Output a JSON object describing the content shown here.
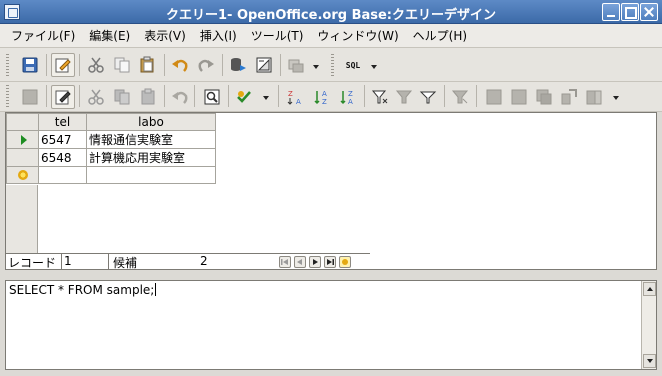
{
  "window": {
    "title": "クエリー1-  OpenOffice.org Base:クエリーデザイン"
  },
  "menu": {
    "items": [
      {
        "label": "ファイル(F)"
      },
      {
        "label": "編集(E)"
      },
      {
        "label": "表示(V)"
      },
      {
        "label": "挿入(I)"
      },
      {
        "label": "ツール(T)"
      },
      {
        "label": "ウィンドウ(W)"
      },
      {
        "label": "ヘルプ(H)"
      }
    ]
  },
  "toolbar1": {
    "sql_label": "SQL"
  },
  "grid": {
    "columns": [
      "tel",
      "labo"
    ],
    "rows": [
      {
        "tel": "6547",
        "labo": "情報通信実験室"
      },
      {
        "tel": "6548",
        "labo": "計算機応用実験室"
      }
    ]
  },
  "navigation": {
    "record_label": "レコード",
    "current_record": "1",
    "candidate_label": "候補",
    "total_count": "2"
  },
  "sql_editor": {
    "text": "SELECT * FROM sample;"
  },
  "colors": {
    "titlebar": "#3c6aa8",
    "row_indicator": "#1e8d22",
    "new_record_indicator": "#e4a910"
  }
}
